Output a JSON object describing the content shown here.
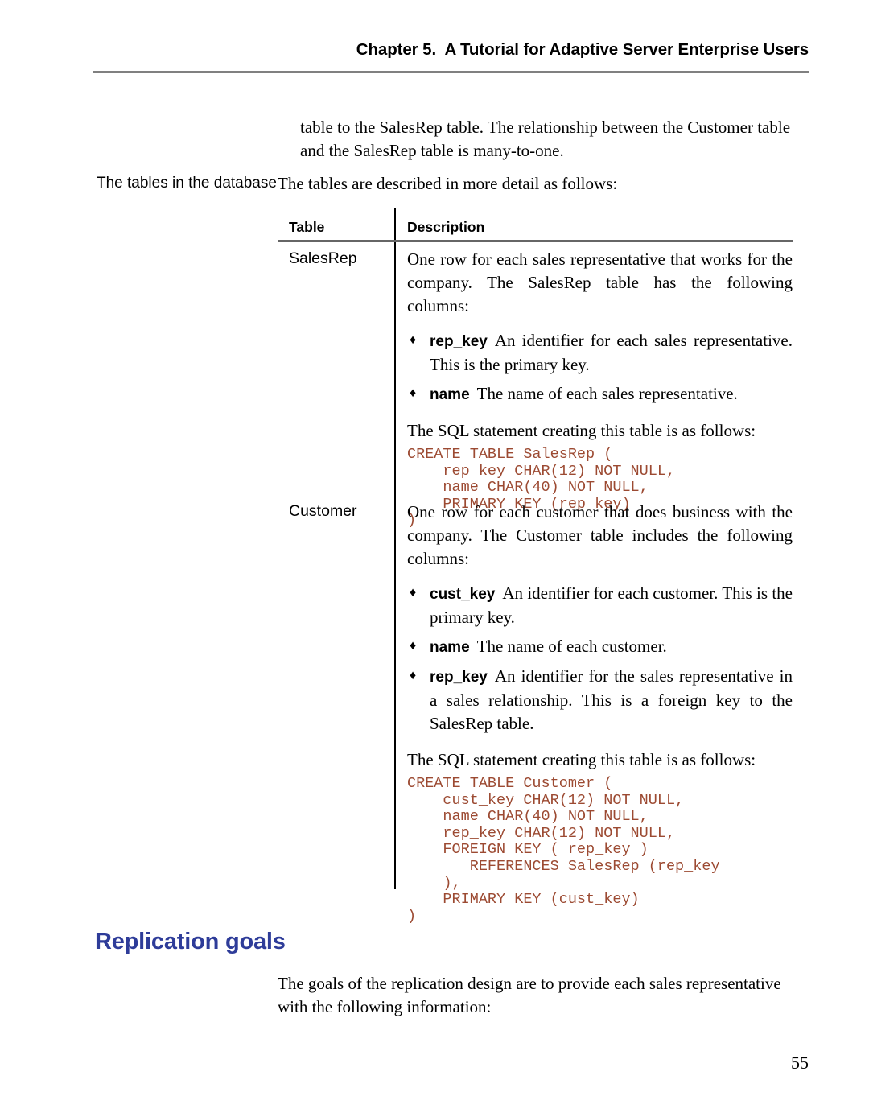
{
  "header": {
    "chapter_title": "Chapter 5.  A Tutorial for Adaptive Server Enterprise Users"
  },
  "intro": {
    "line1": "table to the SalesRep table. The relationship between the Customer table",
    "line2": "and the SalesRep table is many-to-one."
  },
  "margin_note": {
    "text": "The tables in the database"
  },
  "lead_in": {
    "text": "The tables are described in more detail as follows:"
  },
  "table": {
    "headers": {
      "col_table": "Table",
      "col_description": "Description"
    },
    "rows": [
      {
        "name": "SalesRep",
        "description": "One row for each sales representative that works for the company. The SalesRep table has the following columns:",
        "bullets": [
          {
            "term": "rep_key",
            "text": "An identifier for each sales representative. This is the primary key."
          },
          {
            "term": "name",
            "text": "The name of each sales representative."
          }
        ],
        "sql_lead": "The SQL statement creating this table is as follows:",
        "sql": "CREATE TABLE SalesRep (\n    rep_key CHAR(12) NOT NULL,\n    name CHAR(40) NOT NULL,\n    PRIMARY KEY (rep_key)\n)"
      },
      {
        "name": "Customer",
        "description": "One row for each customer that does business with the company. The Customer table includes the following columns:",
        "bullets": [
          {
            "term": "cust_key",
            "text": "An identifier for each customer. This is the primary key."
          },
          {
            "term": "name",
            "text": "The name of each customer."
          },
          {
            "term": "rep_key",
            "text": "An identifier for the sales representative in a sales relationship. This is a foreign key to the SalesRep table."
          }
        ],
        "sql_lead": "The SQL statement creating this table is as follows:",
        "sql": "CREATE TABLE Customer (\n    cust_key CHAR(12) NOT NULL,\n    name CHAR(40) NOT NULL,\n    rep_key CHAR(12) NOT NULL,\n    FOREIGN KEY ( rep_key )\n       REFERENCES SalesRep (rep_key\n    ),\n    PRIMARY KEY (cust_key)\n)"
      }
    ]
  },
  "section": {
    "heading": "Replication goals"
  },
  "closing": {
    "line1": "The goals of the replication design are to provide each sales representative",
    "line2": "with the following information:"
  },
  "footer": {
    "page_number": "55"
  },
  "icons": {
    "bullet": "♦"
  },
  "colors": {
    "heading_blue": "#2E3C99",
    "code_brown": "#9C4A32",
    "rule_gray": "#808080"
  }
}
